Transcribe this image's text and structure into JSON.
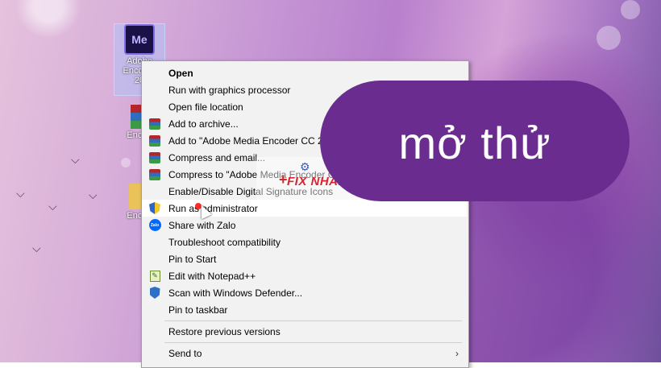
{
  "desktop": {
    "icons": [
      {
        "label_lines": [
          "Adobe",
          "Encoder",
          "20"
        ],
        "icon": "media-encoder-icon"
      },
      {
        "label_lines": [
          "Encod"
        ],
        "icon": "winrar-icon"
      },
      {
        "label_lines": [
          "Encod"
        ],
        "icon": "folder-icon"
      }
    ]
  },
  "context_menu": {
    "items": [
      {
        "label": "Open",
        "bold": true,
        "icon": ""
      },
      {
        "label": "Run with graphics processor",
        "icon": ""
      },
      {
        "label": "Open file location",
        "icon": ""
      },
      {
        "label": "Add to archive...",
        "icon": "winrar-icon"
      },
      {
        "label": "Add to \"Adobe Media Encoder CC 201",
        "icon": "winrar-icon"
      },
      {
        "label": "Compress and email...",
        "icon": "winrar-icon"
      },
      {
        "label": "Compress to \"Adobe Media Encoder CC",
        "icon": "winrar-icon"
      },
      {
        "label": "Enable/Disable Digital Signature Icons",
        "icon": ""
      },
      {
        "label": "Run as administrator",
        "icon": "uac-shield-icon",
        "hover": true
      },
      {
        "label": "Share with Zalo",
        "icon": "zalo-icon"
      },
      {
        "label": "Troubleshoot compatibility",
        "icon": ""
      },
      {
        "label": "Pin to Start",
        "icon": ""
      },
      {
        "label": "Edit with Notepad++",
        "icon": "notepad-plus-plus-icon"
      },
      {
        "label": "Scan with Windows Defender...",
        "icon": "windows-defender-icon"
      },
      {
        "label": "Pin to taskbar",
        "icon": ""
      },
      {
        "label": "Restore previous versions",
        "icon": ""
      },
      {
        "label": "Send to",
        "icon": "",
        "submenu": true
      }
    ]
  },
  "watermark": {
    "text": "FIX NHANH",
    "plus": "+"
  },
  "overlay": {
    "caption": "mở thử",
    "color": "#6a2c8e"
  },
  "icon_glyphs": {
    "zalo": "Zalo",
    "npp": "✎",
    "arrow": "›",
    "me": "Me"
  }
}
